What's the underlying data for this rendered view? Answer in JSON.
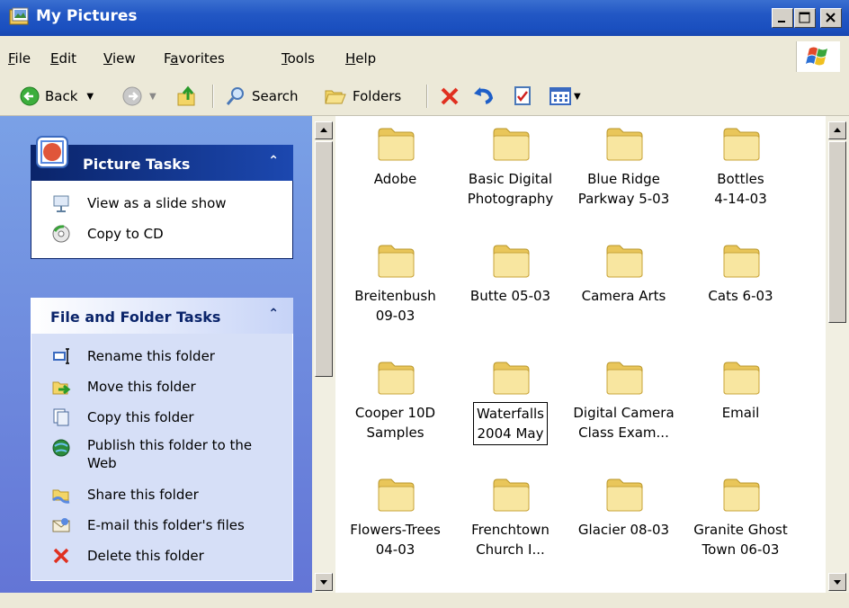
{
  "window": {
    "title": "My Pictures"
  },
  "menu": [
    {
      "label": "File",
      "accel": "F",
      "rest": "ile"
    },
    {
      "label": "Edit",
      "accel": "E",
      "rest": "dit"
    },
    {
      "label": "View",
      "accel": "V",
      "rest": "iew"
    },
    {
      "label": "Favorites",
      "pre": "F",
      "accel": "a",
      "rest": "vorites"
    },
    {
      "label": "Tools",
      "accel": "T",
      "rest": "ools"
    },
    {
      "label": "Help",
      "accel": "H",
      "rest": "elp"
    }
  ],
  "toolbar": {
    "back_label": "Back",
    "search_label": "Search",
    "folders_label": "Folders"
  },
  "picture_tasks": {
    "title": "Picture Tasks",
    "items": [
      {
        "label": "View as a slide show",
        "icon": "slideshow-icon"
      },
      {
        "label": "Copy to CD",
        "icon": "cd-icon"
      }
    ]
  },
  "file_folder_tasks": {
    "title": "File and Folder Tasks",
    "items": [
      {
        "label": "Rename this folder",
        "icon": "rename-icon"
      },
      {
        "label": "Move this folder",
        "icon": "move-icon"
      },
      {
        "label": "Copy this folder",
        "icon": "copy-icon"
      },
      {
        "label_line1": "Publish this folder to the",
        "label_line2": "Web",
        "icon": "publish-web-icon"
      },
      {
        "label": "Share this folder",
        "icon": "share-icon"
      },
      {
        "label": "E-mail this folder's files",
        "icon": "email-icon"
      },
      {
        "label": "Delete this folder",
        "icon": "delete-icon"
      }
    ]
  },
  "folders": [
    {
      "l1": "Adobe",
      "l2": ""
    },
    {
      "l1": "Basic Digital",
      "l2": "Photography"
    },
    {
      "l1": "Blue Ridge",
      "l2": "Parkway 5-03"
    },
    {
      "l1": "Bottles",
      "l2": "4-14-03"
    },
    {
      "l1": "Breitenbush",
      "l2": "09-03"
    },
    {
      "l1": "Butte 05-03",
      "l2": ""
    },
    {
      "l1": "Camera Arts",
      "l2": ""
    },
    {
      "l1": "Cats 6-03",
      "l2": ""
    },
    {
      "l1": "Cooper 10D",
      "l2": "Samples"
    },
    {
      "l1": "Waterfalls",
      "l2": "2004 May",
      "selected": true
    },
    {
      "l1": "Digital Camera",
      "l2": "Class Exam..."
    },
    {
      "l1": "Email",
      "l2": ""
    },
    {
      "l1": "Flowers-Trees",
      "l2": "04-03"
    },
    {
      "l1": "Frenchtown",
      "l2": "Church I..."
    },
    {
      "l1": "Glacier 08-03",
      "l2": ""
    },
    {
      "l1": "Granite Ghost",
      "l2": "Town 06-03"
    }
  ],
  "colors": {
    "title_bar": "#2257c4",
    "task_pane": "#7aa1e6",
    "folder_yellow": "#f5e08a"
  }
}
